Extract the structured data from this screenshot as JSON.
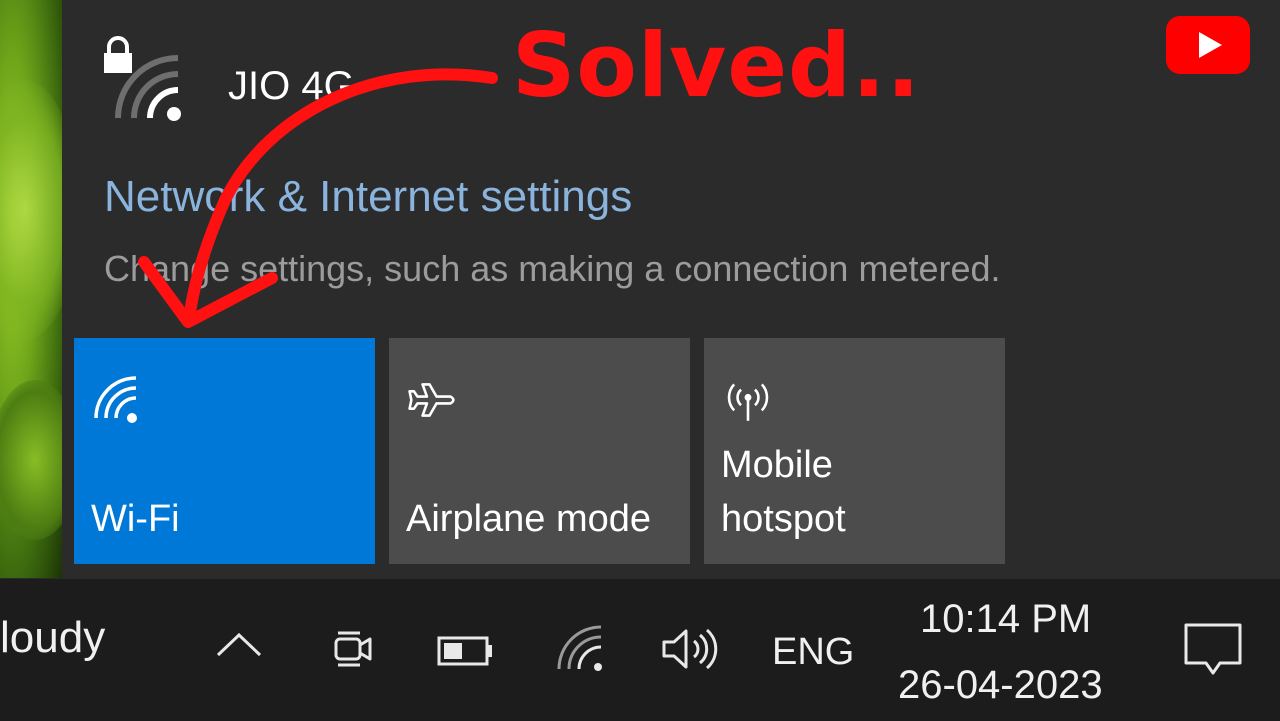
{
  "network": {
    "name": "JIO 4G",
    "settings_link": "Network & Internet settings",
    "settings_desc": "Change settings, such as making a connection metered."
  },
  "quick_actions": [
    {
      "label_lines": [
        "Wi-Fi"
      ],
      "icon": "wifi-icon",
      "state": "on"
    },
    {
      "label_lines": [
        "Airplane mode"
      ],
      "icon": "airplane-icon",
      "state": "off"
    },
    {
      "label_lines": [
        "Mobile",
        "hotspot"
      ],
      "icon": "hotspot-icon",
      "state": "off"
    }
  ],
  "annotation": {
    "title": "Solved..",
    "color": "#ff1111"
  },
  "taskbar": {
    "weather": "loudy",
    "language": "ENG",
    "time": "10:14 PM",
    "date": "26-04-2023"
  },
  "colors": {
    "accent": "#0078d7",
    "tile_off": "#4c4c4c",
    "link": "#8ab4dd",
    "youtube": "#ff0000"
  },
  "icons": {
    "lock": "lock-icon",
    "signal": "wifi-signal-icon",
    "youtube": "youtube-logo",
    "chevron": "chevron-up-icon",
    "meet": "meet-now-icon",
    "battery": "battery-icon",
    "tray_wifi": "wifi-icon",
    "volume": "volume-icon",
    "action_center": "action-center-icon"
  }
}
